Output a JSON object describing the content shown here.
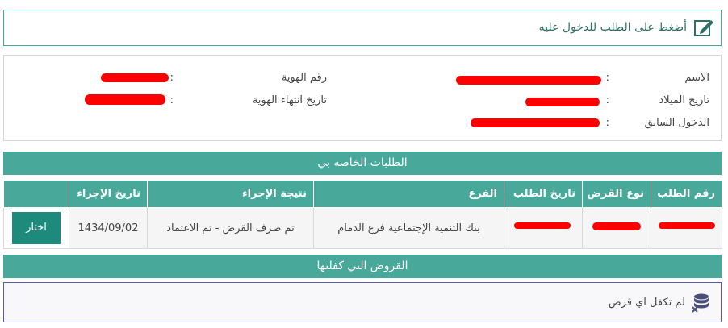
{
  "instruction": {
    "text": "أضغط على الطلب للدخول عليه"
  },
  "info": {
    "name_label": "الاسم",
    "dob_label": "تاريخ الميلاد",
    "last_login_label": "الدخول السابق",
    "id_label": "رقم الهوية",
    "id_expiry_label": "تاريخ انتهاء الهوية",
    "colon": ":"
  },
  "requests": {
    "title": "الطلبات الخاصه بي",
    "headers": [
      "رقم الطلب",
      "نوع القرض",
      "تاريخ الطلب",
      "الفرع",
      "نتيجة الإجراء",
      "تاريخ الإجراء"
    ],
    "rows": [
      {
        "branch": "بنك التنمية الإجتماعية فرع الدمام",
        "result": "تم صرف القرض - تم الاعتماد",
        "action_date": "1434/09/02",
        "button": "اختار"
      }
    ]
  },
  "guarantees": {
    "title": "القروض التي كفلتها",
    "empty_text": "لم تكفل اي قرض"
  },
  "colors": {
    "accent": "#48a99b",
    "button": "#1d8a7b",
    "redaction": "#ff0000"
  }
}
